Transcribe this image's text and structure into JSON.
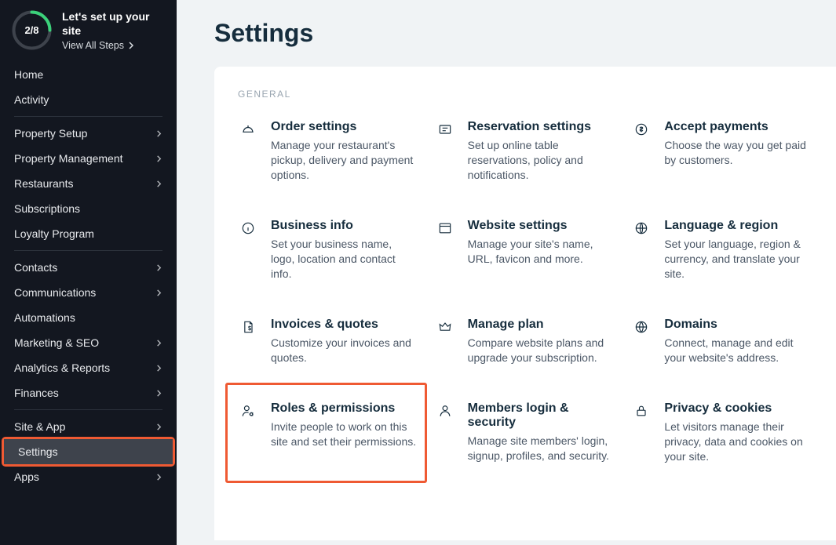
{
  "setup": {
    "counter": "2/8",
    "title": "Let's set up your site",
    "link": "View All Steps",
    "progress_pct": 25
  },
  "nav": {
    "home": "Home",
    "activity": "Activity",
    "prop_setup": "Property Setup",
    "prop_mgmt": "Property Management",
    "restaurants": "Restaurants",
    "subscriptions": "Subscriptions",
    "loyalty": "Loyalty Program",
    "contacts": "Contacts",
    "communications": "Communications",
    "automations": "Automations",
    "marketing": "Marketing & SEO",
    "analytics": "Analytics & Reports",
    "finances": "Finances",
    "siteapp": "Site & App",
    "settings": "Settings",
    "apps": "Apps"
  },
  "page": {
    "title": "Settings",
    "section": "GENERAL"
  },
  "cards": {
    "order": {
      "title": "Order settings",
      "desc": "Manage your restaurant's pickup, delivery and payment options."
    },
    "resv": {
      "title": "Reservation settings",
      "desc": "Set up online table reservations, policy and notifications."
    },
    "payments": {
      "title": "Accept payments",
      "desc": "Choose the way you get paid by customers."
    },
    "bizinfo": {
      "title": "Business info",
      "desc": "Set your business name, logo, location and contact info."
    },
    "website": {
      "title": "Website settings",
      "desc": "Manage your site's name, URL, favicon and more."
    },
    "lang": {
      "title": "Language & region",
      "desc": "Set your language, region & currency, and translate your site."
    },
    "invoices": {
      "title": "Invoices & quotes",
      "desc": "Customize your invoices and quotes."
    },
    "plan": {
      "title": "Manage plan",
      "desc": "Compare website plans and upgrade your subscription."
    },
    "domains": {
      "title": "Domains",
      "desc": "Connect, manage and edit your website's address."
    },
    "roles": {
      "title": "Roles & permissions",
      "desc": "Invite people to work on this site and set their permissions."
    },
    "members": {
      "title": "Members login & security",
      "desc": "Manage site members' login, signup, profiles, and security."
    },
    "privacy": {
      "title": "Privacy & cookies",
      "desc": "Let visitors manage their privacy, data and cookies on your site."
    }
  }
}
